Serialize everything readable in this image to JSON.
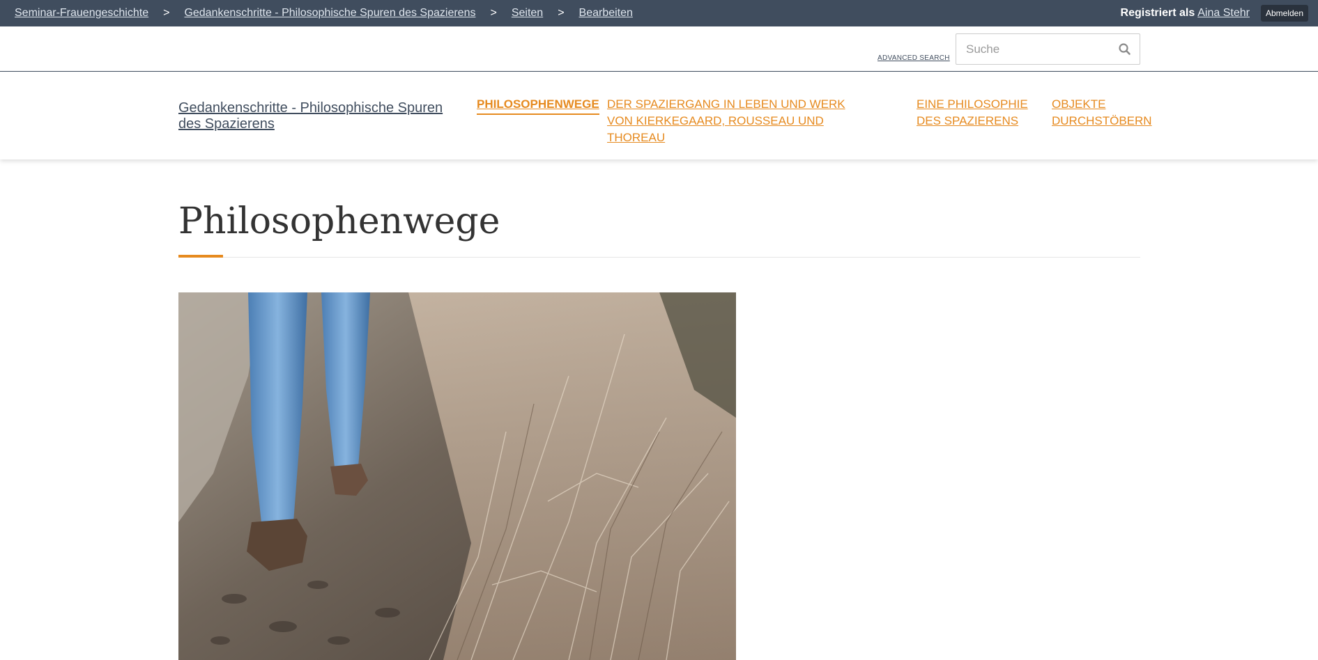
{
  "admin_bar": {
    "breadcrumb": [
      {
        "label": "Seminar-Frauengeschichte"
      },
      {
        "label": "Gedankenschritte - Philosophische Spuren des Spazierens"
      },
      {
        "label": "Seiten"
      },
      {
        "label": "Bearbeiten"
      }
    ],
    "separator": ">",
    "registered_as": "Registriert als",
    "user_name": "Aina Stehr",
    "logout_label": "Abmelden"
  },
  "search": {
    "advanced_label": "ADVANCED SEARCH",
    "placeholder": "Suche",
    "icon": "search-icon"
  },
  "site": {
    "title": "Gedankenschritte - Philosophische Spuren des Spazierens",
    "nav": [
      {
        "label": "Philosophenwege",
        "active": true
      },
      {
        "label": "Der Spaziergang in Leben und Werk von Kierkegaard, Rousseau und Thoreau",
        "active": false
      },
      {
        "label": "Eine Philosophie des Spazierens",
        "active": false
      },
      {
        "label": "Objekte durchstöbern",
        "active": false
      }
    ]
  },
  "main": {
    "page_title": "Philosophenwege"
  },
  "colors": {
    "admin_bar": "#404d5e",
    "accent": "#e68a1f",
    "title_text": "#333333"
  }
}
